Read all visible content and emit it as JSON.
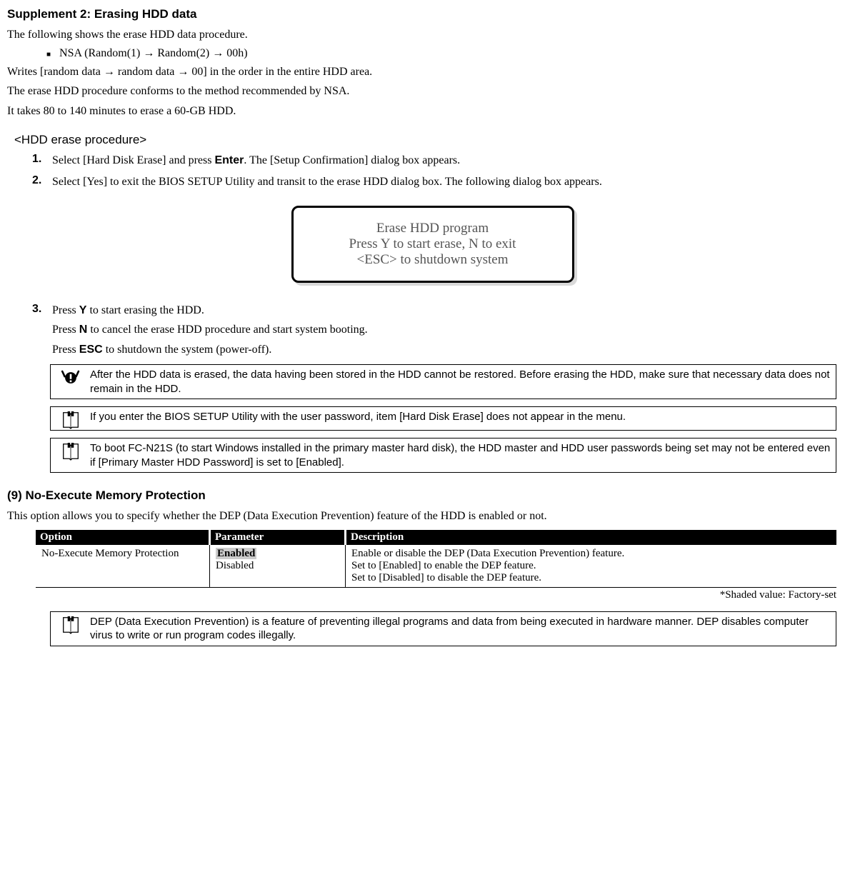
{
  "title": "Supplement 2: Erasing HDD data",
  "intro": "The following shows the erase HDD data procedure.",
  "bullet_text": "NSA (Random(1) → Random(2) → 00h)",
  "bullet_p1": "Writes [random data → random data → 00] in the order in the entire HDD area.",
  "bullet_p2": "The erase HDD procedure conforms to the method recommended by NSA.",
  "bullet_p3": "It takes 80 to 140 minutes to erase a 60-GB HDD.",
  "proc_heading": "<HDD erase procedure>",
  "steps": {
    "s1": {
      "num": "1.",
      "pre": "Select [Hard Disk Erase] and press ",
      "bold": "Enter",
      "post": ". The [Setup Confirmation] dialog box appears."
    },
    "s2": {
      "num": "2.",
      "text": "Select [Yes] to exit the BIOS SETUP Utility and transit to the erase HDD dialog box. The following dialog box appears."
    },
    "s3": {
      "num": "3.",
      "pre": "Press ",
      "bold": "Y",
      "post": " to start erasing the HDD."
    }
  },
  "dialog": {
    "l1": "Erase HDD program",
    "l2": "Press Y to start erase, N to exit",
    "l3": "<ESC> to shutdown system"
  },
  "after3": {
    "p1_pre": "Press ",
    "p1_bold": "N",
    "p1_post": " to cancel the erase HDD procedure and start system booting.",
    "p2_pre": "Press ",
    "p2_bold": "ESC",
    "p2_post": " to shutdown the system (power-off)."
  },
  "notes": {
    "n1": "After the HDD data is erased, the data having been stored in the HDD cannot be restored. Before erasing the HDD, make sure that necessary data does not remain in the HDD.",
    "n2": "If you enter the BIOS SETUP Utility with the user password, item [Hard Disk Erase] does not appear in the menu.",
    "n3": "To boot FC-N21S (to start Windows installed in the primary master hard disk), the HDD master and HDD user passwords being set may not be entered even if [Primary Master HDD Password] is set to [Enabled]."
  },
  "sec9": {
    "heading": "(9) No-Execute Memory Protection",
    "intro": "This option allows you to specify whether the DEP (Data Execution Prevention) feature of the HDD is enabled or not.",
    "th_option": "Option",
    "th_param": "Parameter",
    "th_desc": "Description",
    "row": {
      "option": "No-Execute Memory Protection",
      "param_enabled": "Enabled",
      "param_disabled": "Disabled",
      "desc_l1": "Enable or disable the DEP (Data Execution Prevention) feature.",
      "desc_l2": "Set to [Enabled] to enable the DEP feature.",
      "desc_l3": "Set to [Disabled] to disable the DEP feature."
    },
    "footnote": "*Shaded value: Factory-set",
    "note": "DEP (Data Execution Prevention) is a feature of preventing illegal programs and data from being executed in hardware manner. DEP disables computer virus to write or run program codes illegally."
  }
}
